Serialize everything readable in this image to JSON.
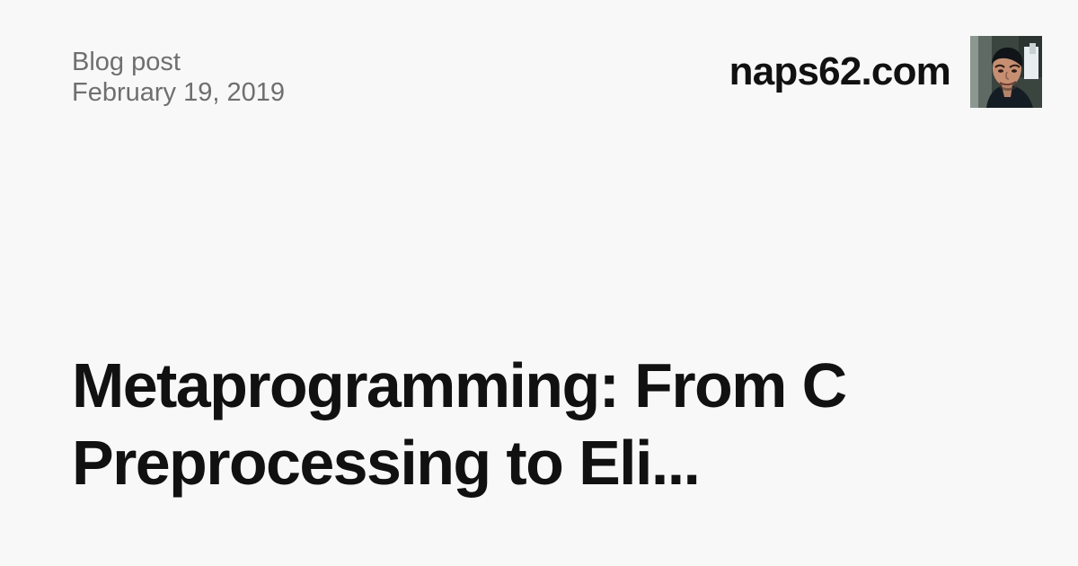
{
  "card": {
    "kind": "Blog post",
    "date": "February 19, 2019",
    "site": "naps62.com",
    "title_line_1": "Metaprogramming: From C",
    "title_line_2": "Preprocessing to Eli..."
  },
  "colors": {
    "background": "#f8f8f8",
    "text": "#111111",
    "muted": "#6f6f6f"
  }
}
